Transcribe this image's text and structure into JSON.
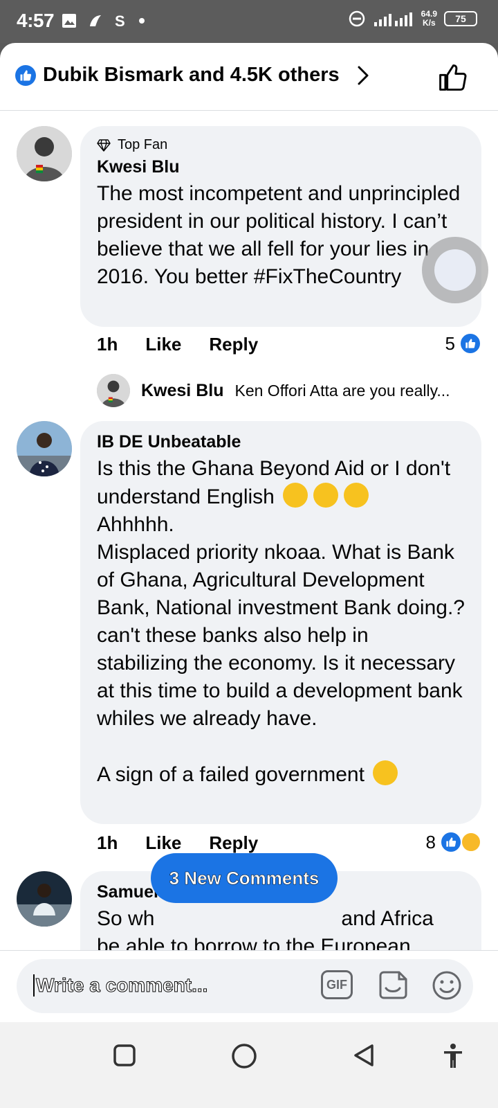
{
  "status_bar": {
    "time": "4:57",
    "network_speed_value": "64.9",
    "network_speed_unit": "K/s",
    "battery": "75"
  },
  "header": {
    "reactors_text": "Dubik Bismark and 4.5K others"
  },
  "comments": [
    {
      "badge": "Top Fan",
      "author": "Kwesi Blu",
      "text": "The most incompetent and unprincipled president in our political history. I can’t believe that we all fell for your lies in 2016. You better #FixTheCountry",
      "time": "1h",
      "like_label": "Like",
      "reply_label": "Reply",
      "reaction_count": "5",
      "reply_preview": {
        "author": "Kwesi Blu",
        "text": "Ken Offori Atta are you really..."
      }
    },
    {
      "author": "IB DE Unbeatable",
      "text_line1": "Is this the Ghana Beyond Aid or I don't understand English",
      "text_rest": "Ahhhhh.\nMisplaced priority nkoaa. What is Bank of Ghana, Agricultural Development Bank, National investment Bank doing.? can't these banks also help in stabilizing the economy. Is it necessary at this time to build a development bank whiles we already have.\n\nA sign of a failed government",
      "time": "1h",
      "like_label": "Like",
      "reply_label": "Reply",
      "reaction_count": "8"
    },
    {
      "author": "Samuel Mensah",
      "text_part1": "So wh",
      "text_part2": "and Africa",
      "text_line2": "be able to borrow to the European"
    }
  ],
  "new_comments_pill": "3 New Comments",
  "composer": {
    "placeholder": "Write a comment...",
    "gif_label": "GIF"
  },
  "icons": [
    "like-icon",
    "chevron-right-icon",
    "thumbs-up-outline-icon",
    "diamond-icon",
    "sticker-icon",
    "smiley-icon",
    "square-nav-icon",
    "circle-home-icon",
    "triangle-back-icon",
    "accessibility-icon"
  ],
  "colors": {
    "accent": "#1b74e4",
    "bubble": "#f0f2f5",
    "text": "#050505"
  }
}
